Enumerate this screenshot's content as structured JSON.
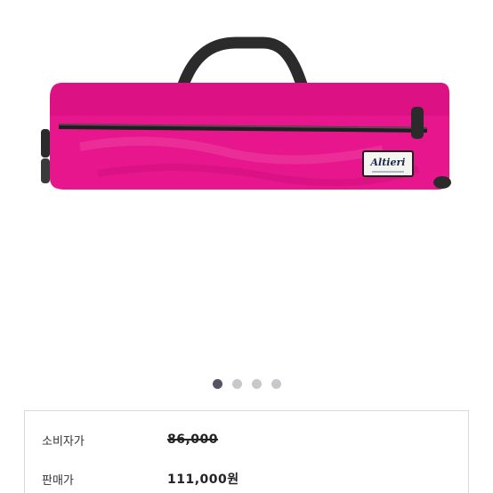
{
  "product": {
    "image_alt": "Pink flute case",
    "brand_label": "Altieri",
    "colors": {
      "case": "#e8168c",
      "strap": "#2b2b2b",
      "zipper": "#1f1f1f"
    }
  },
  "carousel": {
    "count": 4,
    "active_index": 0,
    "active_color": "#545466",
    "inactive_color": "#c8c8cc"
  },
  "pricing": {
    "retail_label": "소비자가",
    "retail_value": "86,000",
    "sale_label": "판매가",
    "sale_value": "111,000원"
  }
}
